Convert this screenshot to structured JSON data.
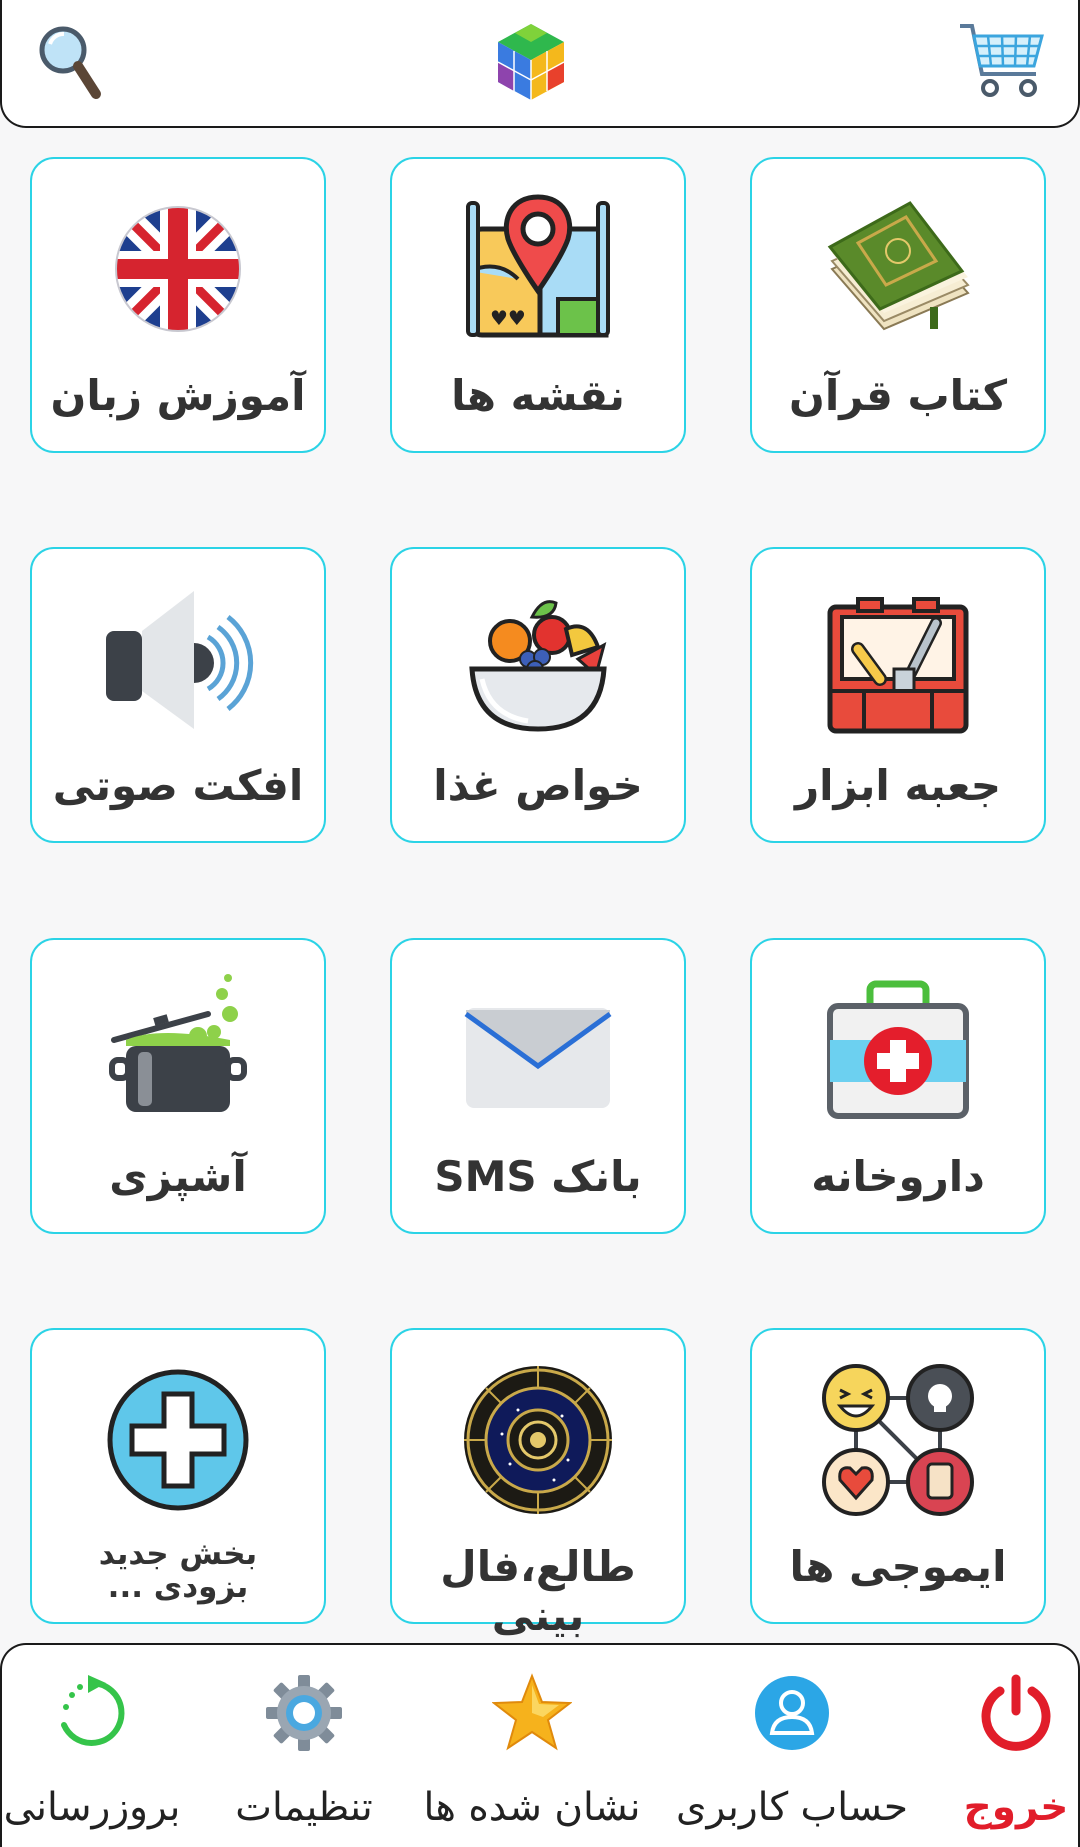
{
  "header": {
    "search_icon": "search-icon",
    "logo_icon": "colorful-cube-logo",
    "cart_icon": "cart-icon"
  },
  "tiles": [
    {
      "label": "کتاب قرآن",
      "icon": "quran-book-icon"
    },
    {
      "label": "نقشه ها",
      "icon": "map-pin-icon"
    },
    {
      "label": "آموزش زبان",
      "icon": "uk-flag-icon"
    },
    {
      "label": "جعبه ابزار",
      "icon": "toolbox-icon"
    },
    {
      "label": "خواص غذا",
      "icon": "fruit-bowl-icon"
    },
    {
      "label": "افکت صوتی",
      "icon": "speaker-icon"
    },
    {
      "label": "داروخانه",
      "icon": "first-aid-kit-icon"
    },
    {
      "label": "بانک SMS",
      "icon": "envelope-icon"
    },
    {
      "label": "آشپزی",
      "icon": "cooking-pot-icon"
    },
    {
      "label": "ایموجی ها",
      "icon": "emoji-icon"
    },
    {
      "label": "طالع،فال بینی",
      "icon": "zodiac-wheel-icon"
    },
    {
      "label_line1": "بخش جدید",
      "label_line2": "بزودی ...",
      "icon": "plus-circle-icon"
    }
  ],
  "bottom_nav": [
    {
      "label": "خروج",
      "icon": "power-icon"
    },
    {
      "label": "حساب کاربری",
      "icon": "user-account-icon"
    },
    {
      "label": "نشان شده ها",
      "icon": "star-icon"
    },
    {
      "label": "تنظیمات",
      "icon": "gear-icon"
    },
    {
      "label": "بروزرسانی",
      "icon": "refresh-icon"
    }
  ],
  "colors": {
    "tile_border": "#2bd3e6",
    "exit_red": "#e11d2a",
    "background": "#f7f7f8"
  }
}
